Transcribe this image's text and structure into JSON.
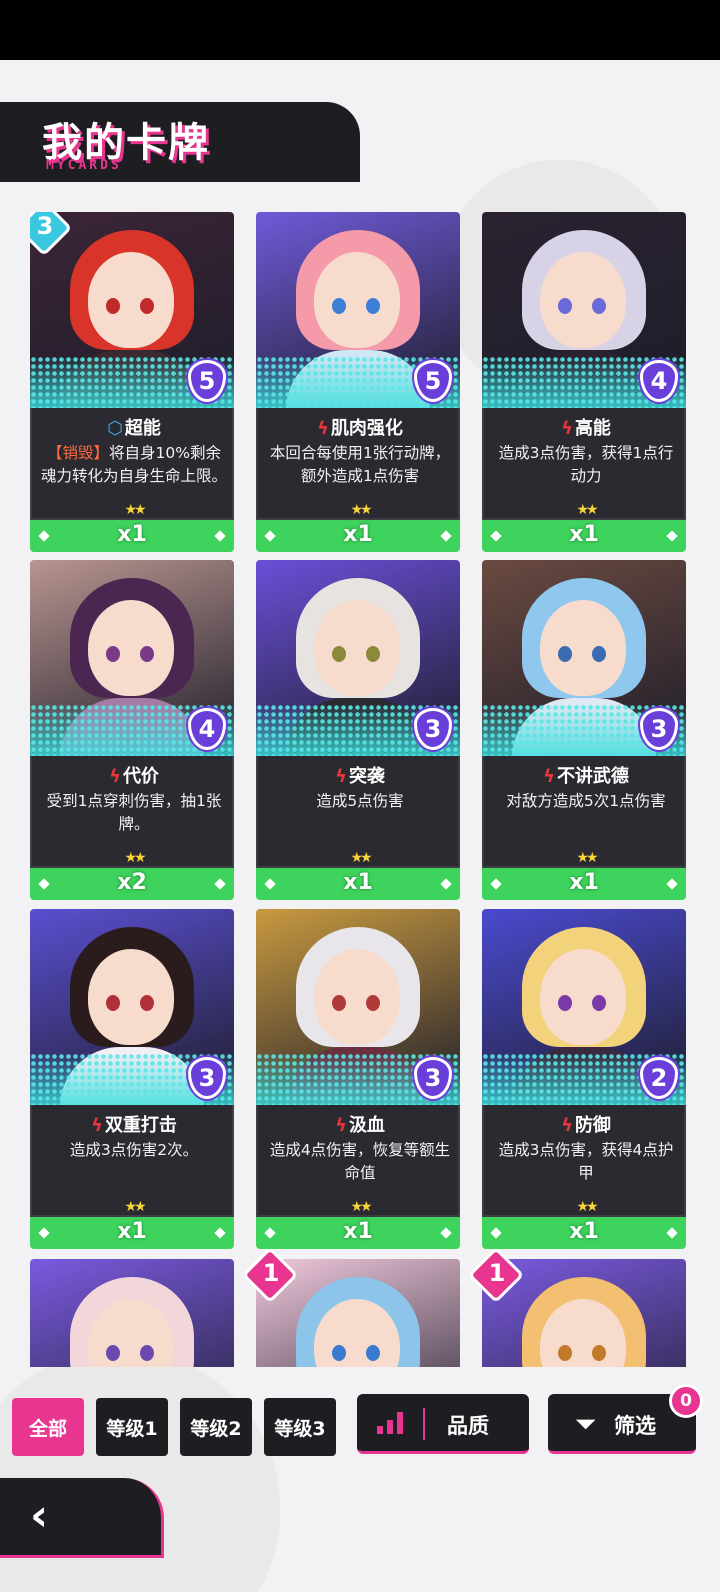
{
  "header": {
    "title": "我的卡牌",
    "subtitle": "MYCARDS"
  },
  "cards": [
    {
      "name": "超能",
      "icon": "shield-icon",
      "tag": "【销毁】",
      "desc": "将自身10%剩余魂力转化为自身生命上限。",
      "cost": "5",
      "rank": "3",
      "count": "x1",
      "stars": "★★",
      "palette": {
        "bg": "#3b2536",
        "hair": "#d8342a",
        "body": "#3a2a30",
        "eye": "#c02a2a"
      }
    },
    {
      "name": "肌肉强化",
      "icon": "lightning-icon",
      "tag": "",
      "desc": "本回合每使用1张行动牌，额外造成1点伤害",
      "cost": "5",
      "rank": "",
      "count": "x1",
      "stars": "★★",
      "palette": {
        "bg": "#6f5ad8",
        "hair": "#f49aa8",
        "body": "#cfe6f4",
        "eye": "#3b7fd6"
      }
    },
    {
      "name": "高能",
      "icon": "lightning-icon",
      "tag": "",
      "desc": "造成3点伤害，获得1点行动力",
      "cost": "4",
      "rank": "",
      "count": "x1",
      "stars": "★★",
      "palette": {
        "bg": "#2a2230",
        "hair": "#d7d2e6",
        "body": "#2b2230",
        "eye": "#6a6ad8"
      }
    },
    {
      "name": "代价",
      "icon": "lightning-icon",
      "tag": "",
      "desc": "受到1点穿刺伤害，抽1张牌。",
      "cost": "4",
      "rank": "",
      "count": "x2",
      "stars": "★★",
      "palette": {
        "bg": "#b89590",
        "hair": "#4a2650",
        "body": "#a57ba6",
        "eye": "#7a3a8a"
      }
    },
    {
      "name": "突袭",
      "icon": "lightning-icon",
      "tag": "",
      "desc": "造成5点伤害",
      "cost": "3",
      "rank": "",
      "count": "x1",
      "stars": "★★",
      "palette": {
        "bg": "#6a4fd8",
        "hair": "#e6e3e0",
        "body": "#2b2a30",
        "eye": "#8a8a3a"
      }
    },
    {
      "name": "不讲武德",
      "icon": "lightning-icon",
      "tag": "",
      "desc": "对敌方造成5次1点伤害",
      "cost": "3",
      "rank": "",
      "count": "x1",
      "stars": "★★",
      "palette": {
        "bg": "#6a4a40",
        "hair": "#8fc7ee",
        "body": "#dfe8f4",
        "eye": "#3a6ab0"
      }
    },
    {
      "name": "双重打击",
      "icon": "lightning-icon",
      "tag": "",
      "desc": "造成3点伤害2次。",
      "cost": "3",
      "rank": "",
      "count": "x1",
      "stars": "★★",
      "palette": {
        "bg": "#5a4fd0",
        "hair": "#2a1c1c",
        "body": "#f2eef6",
        "eye": "#b0303a"
      }
    },
    {
      "name": "汲血",
      "icon": "lightning-icon",
      "tag": "",
      "desc": "造成4点伤害，恢复等额生命值",
      "cost": "3",
      "rank": "",
      "count": "x1",
      "stars": "★★",
      "palette": {
        "bg": "#c89a40",
        "hair": "#e8e6ea",
        "body": "#6a3040",
        "eye": "#b03a3a"
      }
    },
    {
      "name": "防御",
      "icon": "lightning-icon",
      "tag": "",
      "desc": "造成3点伤害，获得4点护甲",
      "cost": "2",
      "rank": "",
      "count": "x1",
      "stars": "★★",
      "palette": {
        "bg": "#4a4ad0",
        "hair": "#f2d27a",
        "body": "#3a2a40",
        "eye": "#7a3aa8"
      }
    },
    {
      "name": "",
      "icon": "",
      "tag": "",
      "desc": "",
      "cost": "",
      "rank": "",
      "count": "",
      "stars": "",
      "palette": {
        "bg": "#7a5ae0",
        "hair": "#f2d6da",
        "body": "#f2d6da",
        "eye": "#6a4ab0"
      }
    },
    {
      "name": "",
      "icon": "",
      "tag": "",
      "desc": "",
      "cost": "",
      "rank": "1",
      "count": "",
      "stars": "",
      "palette": {
        "bg": "#f0c8dc",
        "hair": "#8cc4ea",
        "body": "#8cc4ea",
        "eye": "#3a7ad0"
      }
    },
    {
      "name": "",
      "icon": "",
      "tag": "",
      "desc": "",
      "cost": "",
      "rank": "1",
      "count": "",
      "stars": "",
      "palette": {
        "bg": "#7a5ae0",
        "hair": "#f2c070",
        "body": "#f2c070",
        "eye": "#c07a2a"
      }
    }
  ],
  "filters": {
    "chips": [
      "全部",
      "等级1",
      "等级2",
      "等级3"
    ],
    "active_index": 0,
    "quality_label": "品质",
    "screen_label": "筛选",
    "screen_badge": "0"
  },
  "colors": {
    "accent": "#e8358f",
    "rank_cyan": "#3ac8e0",
    "rank_pink": "#e8358f",
    "count_bar": "#3dd35c"
  }
}
